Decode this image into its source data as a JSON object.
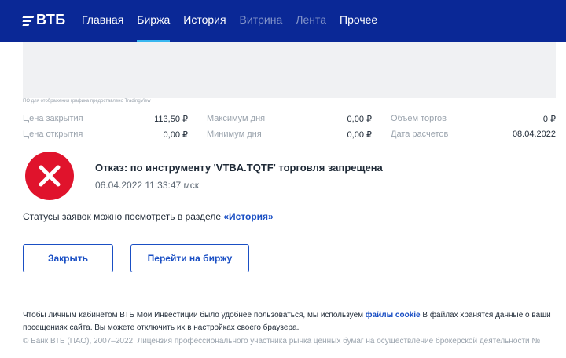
{
  "header": {
    "logo_text": "ВТБ",
    "nav": [
      {
        "label": "Главная",
        "state": "normal"
      },
      {
        "label": "Биржа",
        "state": "active"
      },
      {
        "label": "История",
        "state": "normal"
      },
      {
        "label": "Витрина",
        "state": "dim"
      },
      {
        "label": "Лента",
        "state": "dim"
      },
      {
        "label": "Прочее",
        "state": "normal"
      }
    ]
  },
  "chart": {
    "provider_note": "ПО для отображения графика предоставлено TradingView"
  },
  "stats": [
    [
      {
        "label": "Цена закрытия",
        "value": "113,50 ₽"
      },
      {
        "label": "Максимум дня",
        "value": "0,00 ₽"
      },
      {
        "label": "Объем торгов",
        "value": "0 ₽"
      }
    ],
    [
      {
        "label": "Цена открытия",
        "value": "0,00 ₽"
      },
      {
        "label": "Минимум дня",
        "value": "0,00 ₽"
      },
      {
        "label": "Дата расчетов",
        "value": "08.04.2022"
      }
    ]
  ],
  "error": {
    "title": "Отказ: по инструменту 'VTBA.TQTF' торговля запрещена",
    "timestamp": "06.04.2022 11:33:47 мск",
    "icon": "error-cross-icon",
    "color": "#e0132c"
  },
  "status": {
    "text": "Статусы заявок можно посмотреть в разделе ",
    "link": "«История»"
  },
  "buttons": {
    "close": "Закрыть",
    "exchange": "Перейти на биржу"
  },
  "footer": {
    "cookie_before": "Чтобы личным кабинетом ВТБ Мои Инвестиции было удобнее пользоваться, мы используем ",
    "cookie_link": "файлы cookie",
    "cookie_after": " В файлах хранятся данные о ваши",
    "cookie_line2": "посещениях сайта. Вы можете отключить их в настройках своего браузера.",
    "copyright": "© Банк ВТБ (ПАО), 2007–2022. Лицензия профессионального участника рынка ценных бумаг на осуществление брокерской деятельности №"
  },
  "colors": {
    "header_bg": "#0a2896",
    "accent": "#1a4fc4",
    "active_tab": "#38b7f0"
  }
}
